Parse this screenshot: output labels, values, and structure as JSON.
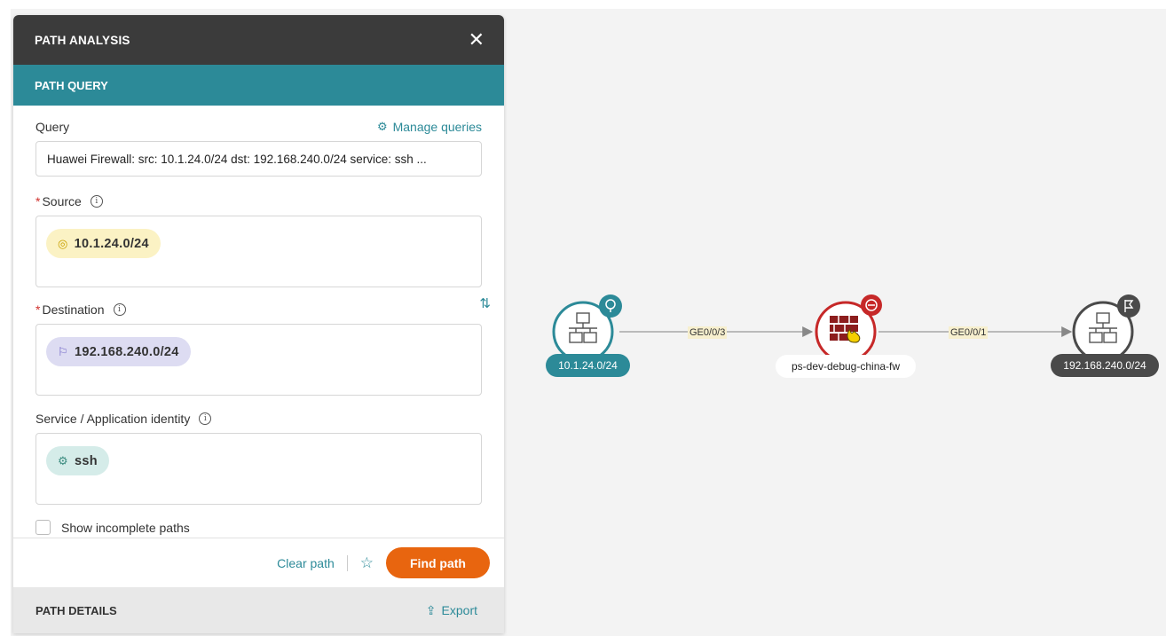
{
  "panel": {
    "title": "PATH ANALYSIS",
    "close_label": "✕",
    "section_title": "PATH QUERY",
    "query": {
      "label": "Query",
      "manage_label": "Manage queries",
      "value": "Huawei Firewall: src: 10.1.24.0/24 dst: 192.168.240.0/24 service: ssh ..."
    },
    "source": {
      "label": "Source",
      "required": "*",
      "chip": "10.1.24.0/24"
    },
    "destination": {
      "label": "Destination",
      "required": "*",
      "chip": "192.168.240.0/24"
    },
    "service": {
      "label": "Service / Application identity",
      "chip": "ssh"
    },
    "show_incomplete_label": "Show incomplete paths",
    "footer": {
      "clear_label": "Clear path",
      "find_label": "Find path"
    },
    "details": {
      "title": "PATH DETAILS",
      "export_label": "Export"
    }
  },
  "graph": {
    "source_node": {
      "label": "10.1.24.0/24",
      "color": "#2c8a98"
    },
    "firewall_node": {
      "label": "ps-dev-debug-china-fw",
      "color": "#c62828"
    },
    "dest_node": {
      "label": "192.168.240.0/24",
      "color": "#4a4a4a"
    },
    "edge1_label": "GE0/0/3",
    "edge2_label": "GE0/0/1"
  },
  "colors": {
    "accent": "#2c8a98",
    "header": "#3b3b3b",
    "primary_button": "#e8650f"
  }
}
